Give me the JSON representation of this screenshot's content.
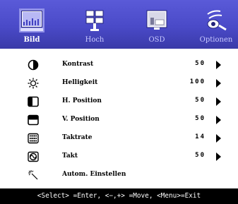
{
  "tabs": [
    {
      "label": "Bild",
      "icon": "picture-icon",
      "active": true
    },
    {
      "label": "Hoch",
      "icon": "advanced-icon",
      "active": false
    },
    {
      "label": "OSD",
      "icon": "osd-icon",
      "active": false
    },
    {
      "label": "Optionen",
      "icon": "options-icon",
      "active": false
    }
  ],
  "menu": [
    {
      "label": "Kontrast",
      "value": "50",
      "icon": "contrast-icon",
      "arrow": true
    },
    {
      "label": "Helligkeit",
      "value": "100",
      "icon": "brightness-icon",
      "arrow": true
    },
    {
      "label": "H. Position",
      "value": "50",
      "icon": "h-position-icon",
      "arrow": true
    },
    {
      "label": "V. Position",
      "value": "50",
      "icon": "v-position-icon",
      "arrow": true
    },
    {
      "label": "Taktrate",
      "value": "14",
      "icon": "clock-rate-icon",
      "arrow": true
    },
    {
      "label": "Takt",
      "value": "50",
      "icon": "phase-icon",
      "arrow": true
    },
    {
      "label": "Autom. Einstellen",
      "value": "",
      "icon": "auto-adjust-icon",
      "arrow": false
    }
  ],
  "footer": {
    "hint": "<Select> =Enter, <−,+> =Move, <Menu>=Exit"
  },
  "colors": {
    "header_bg": "#4a4ac8",
    "active_tab_bg": "#9090e8",
    "footer_bg": "#000000"
  }
}
